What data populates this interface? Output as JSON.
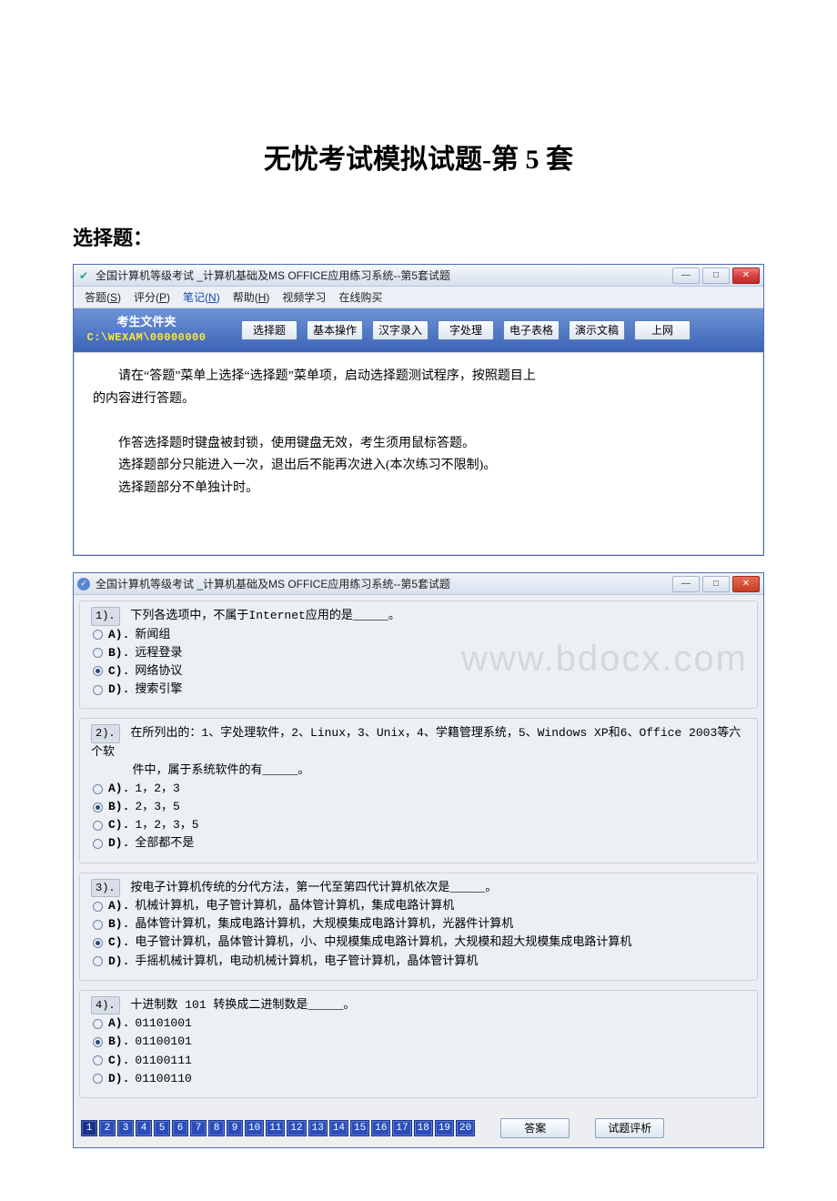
{
  "document": {
    "title": "无忧考试模拟试题-第 5 套",
    "section_heading": "选择题："
  },
  "watermark": "www.bdocx.com",
  "window1": {
    "title": "全国计算机等级考试 _计算机基础及MS OFFICE应用练习系统--第5套试题",
    "menu": [
      {
        "label": "答题",
        "hotkey": "S"
      },
      {
        "label": "评分",
        "hotkey": "P"
      },
      {
        "label": "笔记",
        "hotkey": "N",
        "blue": true
      },
      {
        "label": "帮助",
        "hotkey": "H"
      },
      {
        "label": "视频学习"
      },
      {
        "label": "在线购买"
      }
    ],
    "folder": {
      "label": "考生文件夹",
      "path": "C:\\WEXAM\\00000000"
    },
    "tabs": [
      "选择题",
      "基本操作",
      "汉字录入",
      "字处理",
      "电子表格",
      "演示文稿",
      "上网"
    ],
    "instructions": [
      "请在“答题”菜单上选择“选择题”菜单项，启动选择题测试程序，按照题目上",
      "的内容进行答题。",
      "",
      "作答选择题时键盘被封锁，使用键盘无效，考生须用鼠标答题。",
      "选择题部分只能进入一次，退出后不能再次进入(本次练习不限制)。",
      "选择题部分不单独计时。"
    ]
  },
  "window2": {
    "title": "全国计算机等级考试 _计算机基础及MS OFFICE应用练习系统--第5套试题",
    "questions": [
      {
        "num": "1).",
        "text": "下列各选项中，不属于Internet应用的是_____。",
        "options": [
          {
            "label": "A).",
            "text": "新闻组",
            "selected": false
          },
          {
            "label": "B).",
            "text": "远程登录",
            "selected": false
          },
          {
            "label": "C).",
            "text": "网络协议",
            "selected": true
          },
          {
            "label": "D).",
            "text": "搜索引擎",
            "selected": false
          }
        ]
      },
      {
        "num": "2).",
        "text": "在所列出的：1、字处理软件，2、Linux，3、Unix，4、学籍管理系统，5、Windows XP和6、Office 2003等六个软",
        "text2": "件中，属于系统软件的有_____。",
        "options": [
          {
            "label": "A).",
            "text": "1，2，3",
            "selected": false
          },
          {
            "label": "B).",
            "text": "2，3，5",
            "selected": true
          },
          {
            "label": "C).",
            "text": "1，2，3，5",
            "selected": false
          },
          {
            "label": "D).",
            "text": "全部都不是",
            "selected": false
          }
        ]
      },
      {
        "num": "3).",
        "text": "按电子计算机传统的分代方法，第一代至第四代计算机依次是_____。",
        "options": [
          {
            "label": "A).",
            "text": "机械计算机，电子管计算机，晶体管计算机，集成电路计算机",
            "selected": false
          },
          {
            "label": "B).",
            "text": "晶体管计算机，集成电路计算机，大规模集成电路计算机，光器件计算机",
            "selected": false
          },
          {
            "label": "C).",
            "text": "电子管计算机，晶体管计算机，小、中规模集成电路计算机，大规模和超大规模集成电路计算机",
            "selected": true
          },
          {
            "label": "D).",
            "text": "手摇机械计算机，电动机械计算机，电子管计算机，晶体管计算机",
            "selected": false
          }
        ]
      },
      {
        "num": "4).",
        "text": "十进制数 101 转换成二进制数是_____。",
        "options": [
          {
            "label": "A).",
            "text": "01101001",
            "selected": false
          },
          {
            "label": "B).",
            "text": "01100101",
            "selected": true
          },
          {
            "label": "C).",
            "text": "01100111",
            "selected": false
          },
          {
            "label": "D).",
            "text": "01100110",
            "selected": false
          }
        ]
      }
    ],
    "pages": [
      "1",
      "2",
      "3",
      "4",
      "5",
      "6",
      "7",
      "8",
      "9",
      "10",
      "11",
      "12",
      "13",
      "14",
      "15",
      "16",
      "17",
      "18",
      "19",
      "20"
    ],
    "active_page": "1",
    "buttons": {
      "answers": "答案",
      "analysis": "试题评析"
    }
  }
}
